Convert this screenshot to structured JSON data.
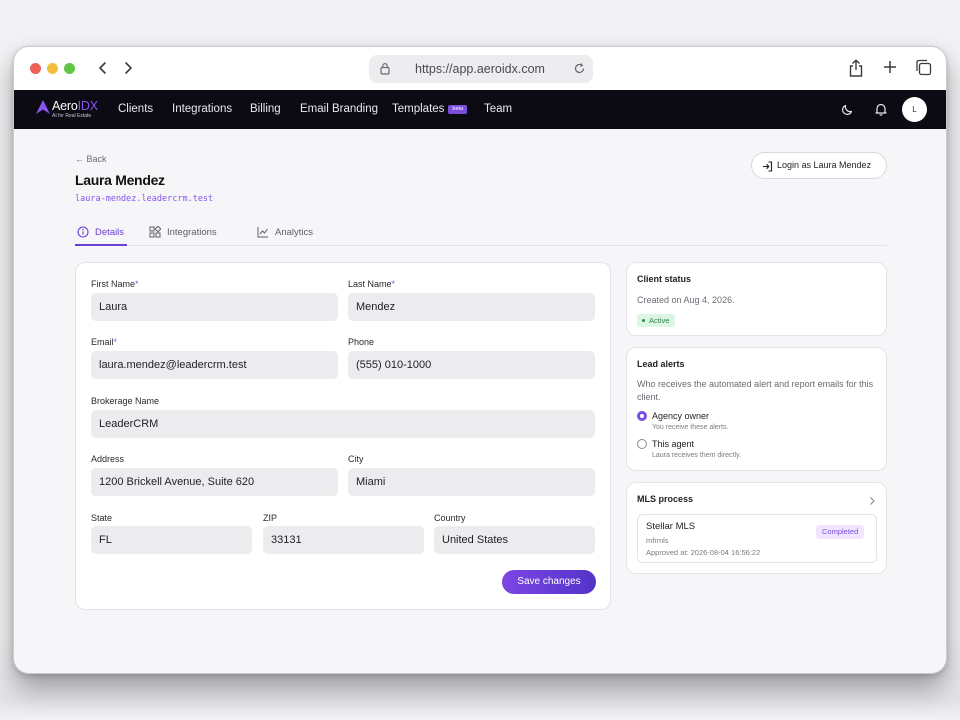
{
  "browser": {
    "url": "https://app.aeroidx.com"
  },
  "nav": {
    "brand_main": "Aero",
    "brand_accent": "IDX",
    "brand_tagline": "AI for Real Estate",
    "items": [
      "Clients",
      "Integrations",
      "Billing",
      "Email Branding",
      "Templates",
      "Team"
    ],
    "beta_label": "beta",
    "avatar_initial": "L"
  },
  "header": {
    "back_label": "← Back",
    "client_name": "Laura Mendez",
    "client_domain": "laura-mendez.leadercrm.test",
    "login_as_label": "Login as Laura Mendez"
  },
  "tabs": [
    {
      "label": "Details",
      "active": true
    },
    {
      "label": "Integrations",
      "active": false
    },
    {
      "label": "Analytics",
      "active": false
    }
  ],
  "form": {
    "first_name": {
      "label": "First Name",
      "required": "*",
      "value": "Laura"
    },
    "last_name": {
      "label": "Last Name",
      "required": "*",
      "value": "Mendez"
    },
    "email": {
      "label": "Email",
      "required": "*",
      "value": "laura.mendez@leadercrm.test"
    },
    "phone": {
      "label": "Phone",
      "value": "(555) 010-1000"
    },
    "brokerage": {
      "label": "Brokerage Name",
      "value": "LeaderCRM"
    },
    "address": {
      "label": "Address",
      "value": "1200 Brickell Avenue, Suite 620"
    },
    "city": {
      "label": "City",
      "value": "Miami"
    },
    "state": {
      "label": "State",
      "value": "FL"
    },
    "zip": {
      "label": "ZIP",
      "value": "33131"
    },
    "country": {
      "label": "Country",
      "value": "United States"
    },
    "save_label": "Save changes"
  },
  "client_status": {
    "title": "Client status",
    "created": "Created on Aug 4, 2026.",
    "badge": "Active"
  },
  "lead_alerts": {
    "title": "Lead alerts",
    "description": "Who receives the automated alert and report emails for this client.",
    "options": [
      {
        "label": "Agency owner",
        "sub": "You receive these alerts.",
        "checked": true
      },
      {
        "label": "This agent",
        "sub": "Laura receives them directly.",
        "checked": false
      }
    ]
  },
  "mls_process": {
    "title": "MLS process",
    "name": "Stellar MLS",
    "code": "mfrmls",
    "approved": "Approved at: 2026-08-04 16:56:22",
    "badge": "Completed"
  },
  "colors": {
    "accent": "#7b4ddf",
    "nav_bg": "#0c0b14",
    "active_green": "#2c8a48"
  }
}
